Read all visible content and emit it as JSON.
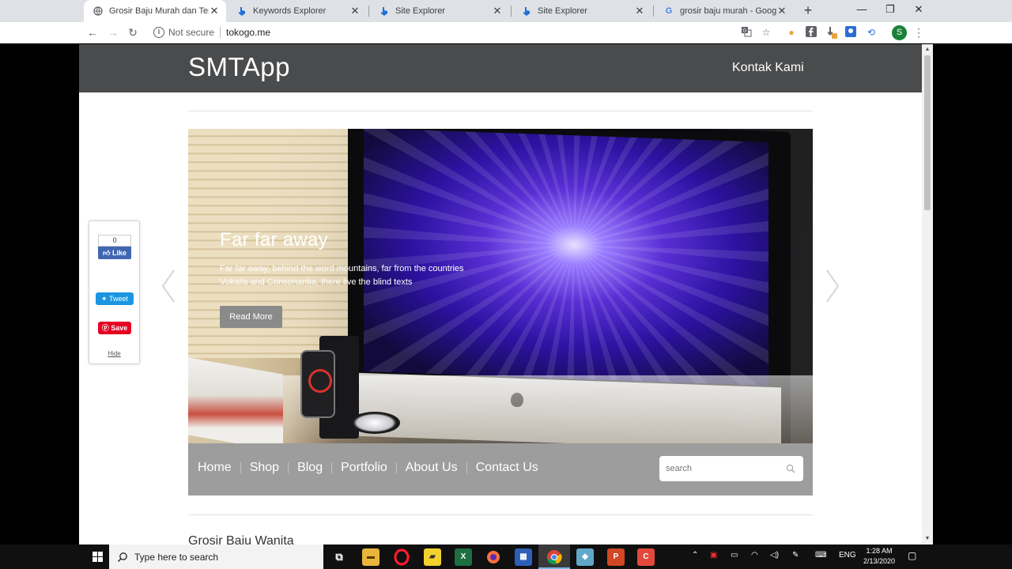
{
  "browser": {
    "tabs": [
      {
        "title": "Grosir Baju Murah dan Terlengkap",
        "icon": "globe-icon",
        "active": true
      },
      {
        "title": "Keywords Explorer",
        "icon": "ahrefs-icon",
        "active": false
      },
      {
        "title": "Site Explorer",
        "icon": "ahrefs-icon",
        "active": false
      },
      {
        "title": "Site Explorer",
        "icon": "ahrefs-icon",
        "active": false
      },
      {
        "title": "grosir baju murah - Google Search",
        "icon": "google-icon",
        "active": false
      }
    ],
    "security_label": "Not secure",
    "url": "tokogo.me",
    "profile_initial": "S"
  },
  "site": {
    "brand": "SMTApp",
    "header_link": "Kontak Kami",
    "slide": {
      "title": "Far far away",
      "text": "Far far away, behind the word mountains, far from the countries Vokalia and Consonantia, there live the blind texts",
      "button": "Read More"
    },
    "nav": [
      "Home",
      "Shop",
      "Blog",
      "Portfolio",
      "About Us",
      "Contact Us"
    ],
    "search_placeholder": "search",
    "section_title": "Grosir Baju Wanita"
  },
  "share_widget": {
    "like_count": "0",
    "like_label": "Like",
    "tweet_label": "Tweet",
    "save_label": "Save",
    "hide_label": "Hide"
  },
  "taskbar": {
    "search_placeholder": "Type here to search",
    "language": "ENG",
    "time": "1:28 AM",
    "date": "2/13/2020"
  },
  "colors": {
    "header_bg": "#4a4b4c",
    "subnav_bg": "#9d9d9d",
    "facebook": "#4267b2",
    "twitter": "#1b95e0",
    "pinterest": "#e60023"
  }
}
